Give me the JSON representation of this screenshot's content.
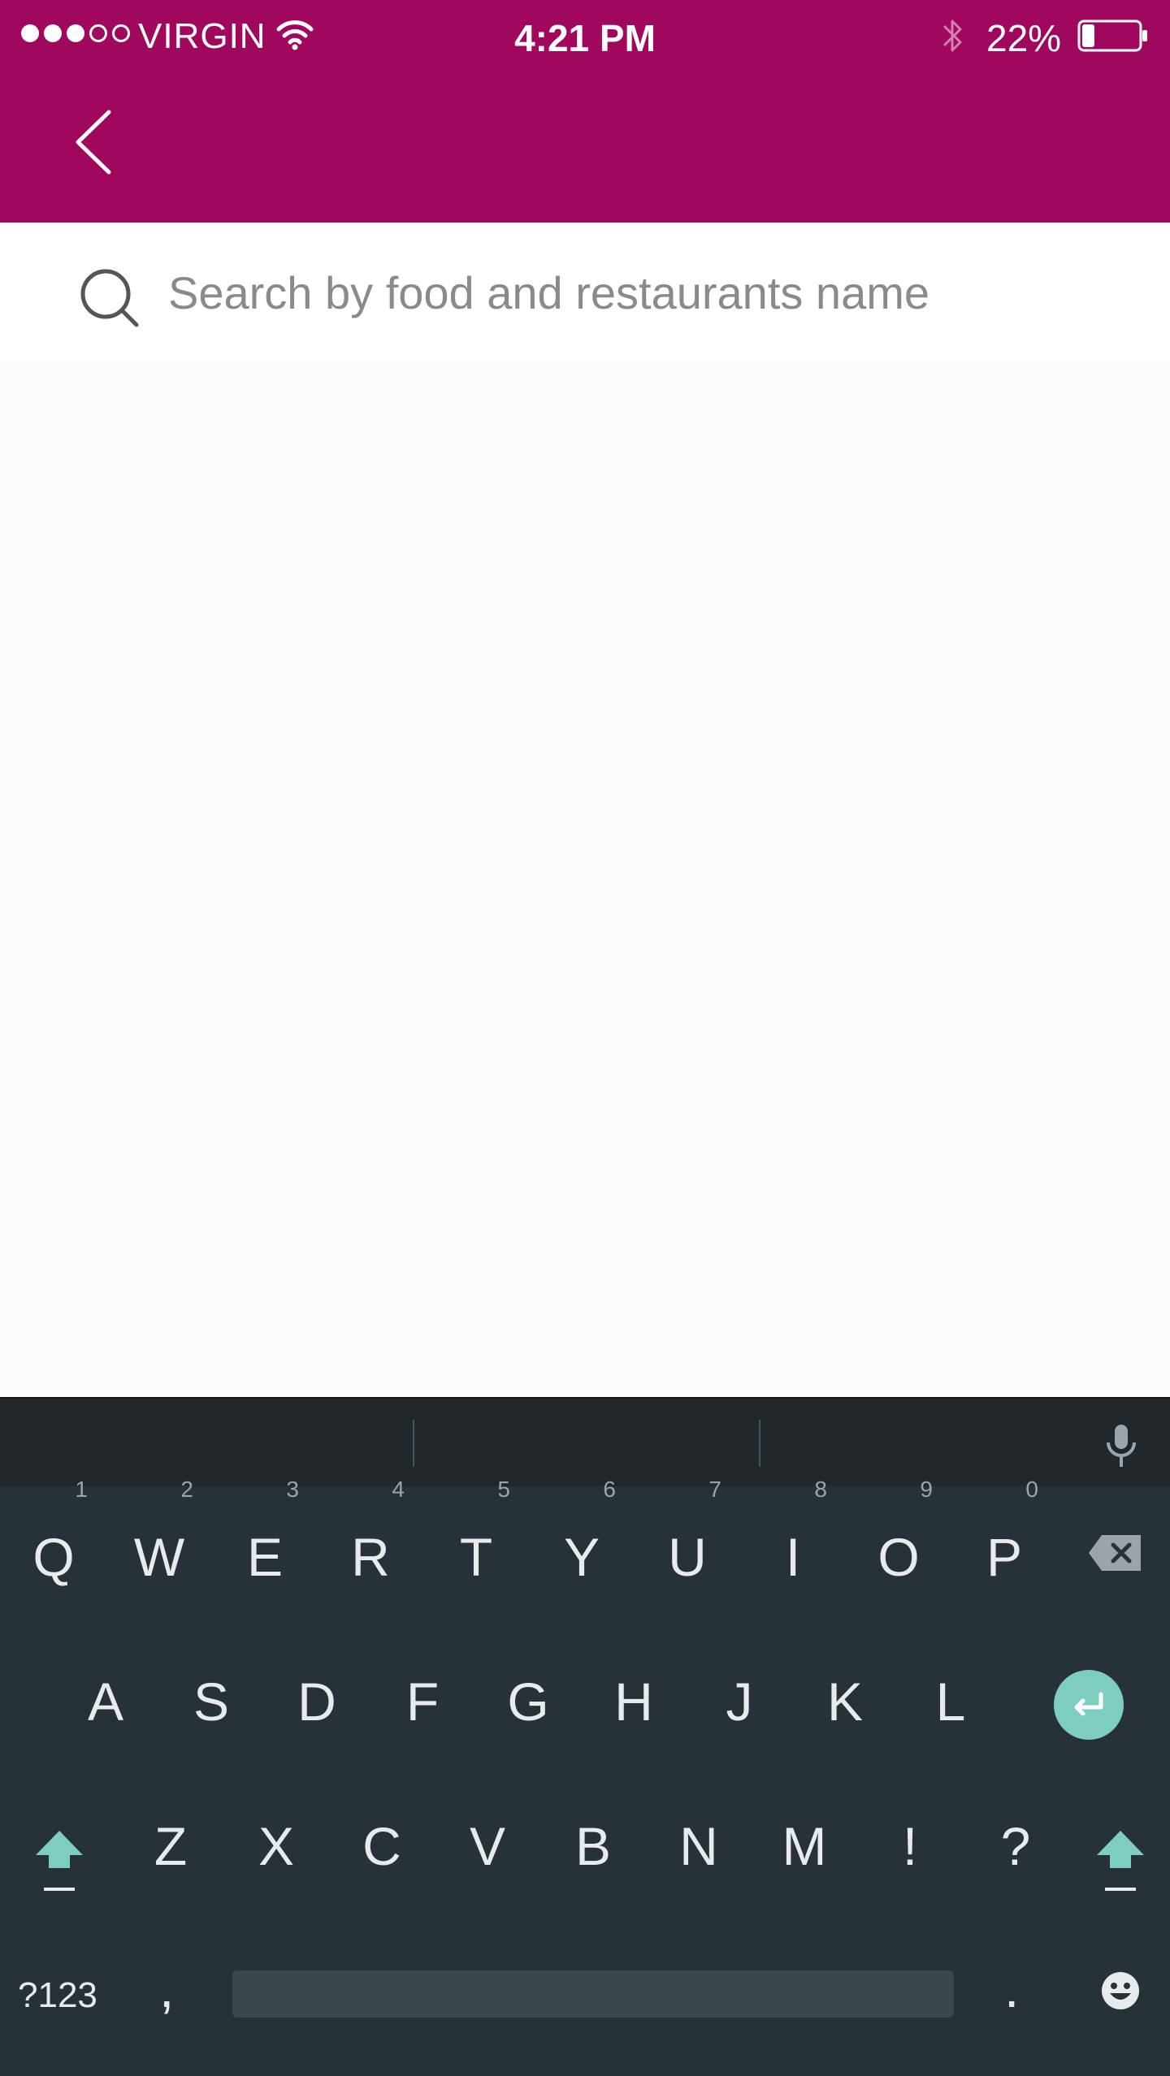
{
  "status_bar": {
    "carrier": "VIRGIN",
    "time": "4:21 PM",
    "battery_percent": "22%",
    "signal_bars_filled": 3,
    "signal_bars_total": 5,
    "battery_level": 0.22
  },
  "header": {
    "background_color": "#A0085D",
    "back_icon": "chevron-left-icon"
  },
  "search": {
    "placeholder": "Search by food and restaurants name",
    "value": "",
    "icon": "search-icon"
  },
  "keyboard": {
    "row1": [
      {
        "label": "Q",
        "hint": "1"
      },
      {
        "label": "W",
        "hint": "2"
      },
      {
        "label": "E",
        "hint": "3"
      },
      {
        "label": "R",
        "hint": "4"
      },
      {
        "label": "T",
        "hint": "5"
      },
      {
        "label": "Y",
        "hint": "6"
      },
      {
        "label": "U",
        "hint": "7"
      },
      {
        "label": "I",
        "hint": "8"
      },
      {
        "label": "O",
        "hint": "9"
      },
      {
        "label": "P",
        "hint": "0"
      }
    ],
    "row2": [
      "A",
      "S",
      "D",
      "F",
      "G",
      "H",
      "J",
      "K",
      "L"
    ],
    "row3": [
      "Z",
      "X",
      "C",
      "V",
      "B",
      "N",
      "M",
      "!",
      "?"
    ],
    "mode_label": "?123",
    "comma_label": ",",
    "period_label": ".",
    "accent_color": "#7ECDC1"
  }
}
